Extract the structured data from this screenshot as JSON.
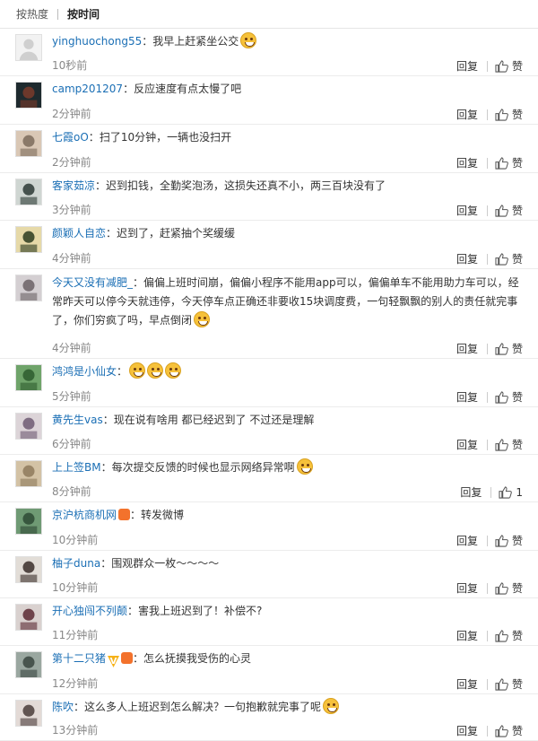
{
  "sort": {
    "hot": "按热度",
    "time": "按时间"
  },
  "reply_label": "回复",
  "like_label": "赞",
  "comments": [
    {
      "user": "yinghuochong55",
      "sep": "：",
      "text": "我早上赶紧坐公交",
      "time": "10秒前",
      "emoji": "grin-emoji",
      "like": "赞",
      "avatar": "default-avatar"
    },
    {
      "user": "camp201207",
      "sep": "：",
      "text": "反应速度有点太慢了吧",
      "time": "2分钟前",
      "like": "赞",
      "avatar": "dark-photo-avatar"
    },
    {
      "user": "七霞oO",
      "sep": "：",
      "text": "扫了10分钟，一辆也没扫开",
      "time": "2分钟前",
      "like": "赞",
      "avatar": "cat-avatar"
    },
    {
      "user": "客家茹凉",
      "sep": "：",
      "text": "迟到扣钱，全勤奖泡汤，这损失还真不小，两三百块没有了",
      "time": "3分钟前",
      "like": "赞",
      "avatar": "person-avatar"
    },
    {
      "user": "颜颖人自恋",
      "sep": "：",
      "text": "迟到了，赶紧抽个奖缓缓",
      "time": "4分钟前",
      "like": "赞",
      "avatar": "tree-avatar"
    },
    {
      "user": "今天又没有减肥_",
      "sep": "：",
      "text": "偏偏上班时间崩，偏偏小程序不能用app可以，偏偏单车不能用助力车可以，经常昨天可以停今天就违停，今天停车点正确还非要收15块调度费，一句轻飘飘的别人的责任就完事了，你们穷疯了吗，早点倒闭",
      "time": "4分钟前",
      "emoji": "grin-emoji",
      "like": "赞",
      "avatar": "animal-avatar"
    },
    {
      "user": "鸿鸿是小仙女",
      "sep": "：",
      "text": "",
      "time": "5分钟前",
      "emoji_triple": "laugh-cry-emoji",
      "like": "赞",
      "avatar": "green-avatar"
    },
    {
      "user": "黄先生vas",
      "sep": "：",
      "text": "现在说有啥用 都已经迟到了 不过还是理解",
      "time": "6分钟前",
      "like": "赞",
      "avatar": "girl-avatar"
    },
    {
      "user": "上上签BM",
      "sep": "：",
      "text": "每次提交反馈的时候也显示网络异常啊",
      "time": "8分钟前",
      "emoji": "hungry-emoji",
      "like": "1",
      "avatar": "room-avatar"
    },
    {
      "user": "京沪杭商机网",
      "sep": "：",
      "text": "转发微博",
      "time": "10分钟前",
      "like": "赞",
      "avatar": "building-avatar",
      "badge": "red"
    },
    {
      "user": "柚子duna",
      "sep": "：",
      "text": "围观群众一枚～～～～",
      "time": "10分钟前",
      "like": "赞",
      "avatar": "woman-avatar"
    },
    {
      "user": "开心独闯不列颠",
      "sep": "：",
      "text": "害我上班迟到了！补偿不?",
      "time": "11分钟前",
      "like": "赞",
      "avatar": "lady-avatar"
    },
    {
      "user": "第十二只猪",
      "sep": "：",
      "text": "怎么抚摸我受伤的心灵",
      "time": "12分钟前",
      "like": "赞",
      "avatar": "pig-avatar",
      "badge": "vip"
    },
    {
      "user": "陈吹",
      "sep": "：",
      "text": "这么多人上班迟到怎么解决？一句抱歉就完事了呢",
      "time": "13分钟前",
      "emoji": "surprised-emoji",
      "like": "赞",
      "avatar": "face-avatar"
    }
  ],
  "colors": {
    "link": "#1b6fb5",
    "text": "#333333",
    "muted": "#888888",
    "divider": "#ececec"
  }
}
